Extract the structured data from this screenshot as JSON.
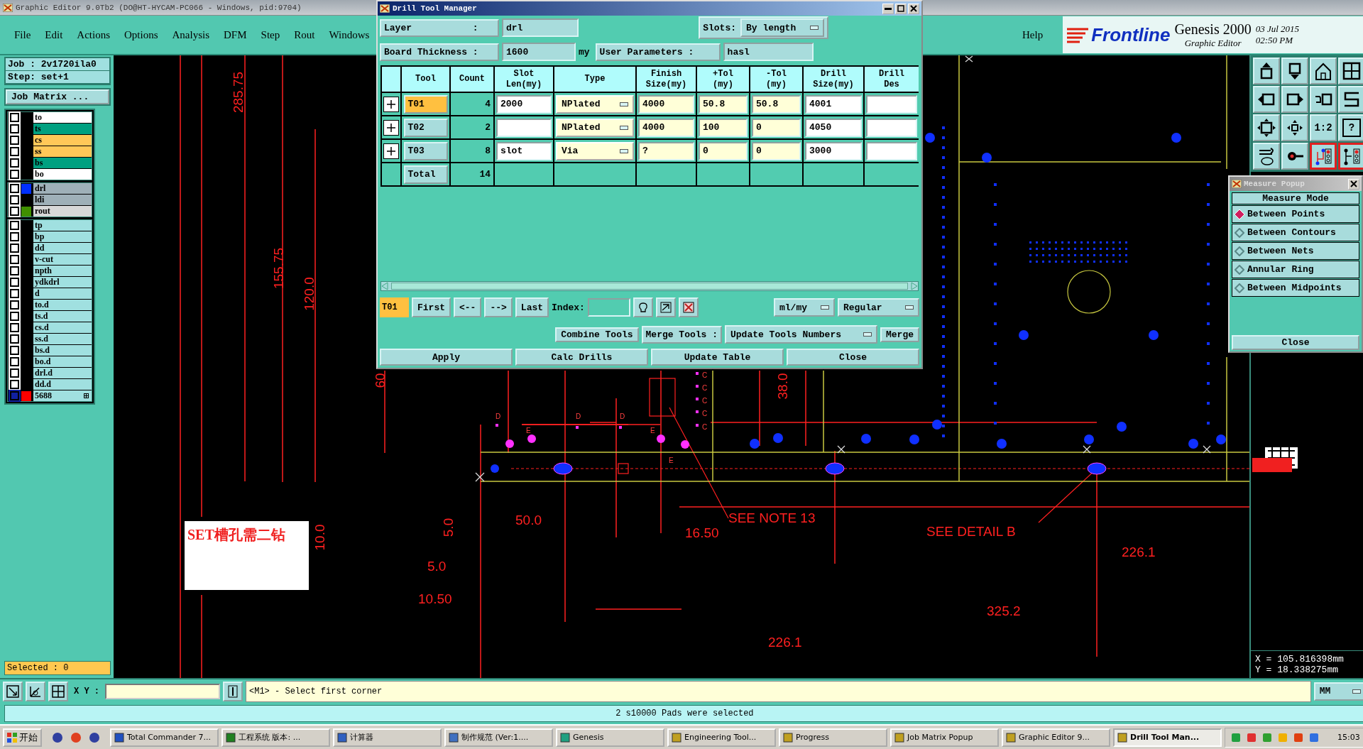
{
  "main_window": {
    "title": "Graphic Editor 9.0Tb2 (DO@HT-HYCAM-PC066 - Windows, pid:9704)"
  },
  "menu": [
    "File",
    "Edit",
    "Actions",
    "Options",
    "Analysis",
    "DFM",
    "Step",
    "Rout",
    "Windows"
  ],
  "help_menu": "Help",
  "brand": {
    "logo": "Frontline",
    "product": "Genesis 2000",
    "subtitle": "Graphic Editor",
    "date": "03 Jul 2015",
    "time": "02:50 PM"
  },
  "job_panel": {
    "job": "Job : 2v1720ila0",
    "step": "Step: set+1",
    "matrix_button": "Job Matrix ...",
    "selected": "Selected : 0"
  },
  "layer_groups": [
    {
      "layers": [
        {
          "name": "to",
          "color": "#ffffff",
          "affected": false
        },
        {
          "name": "ts",
          "color": "#00a080",
          "affected": false
        },
        {
          "name": "cs",
          "color": "#ffc858",
          "affected": false
        },
        {
          "name": "ss",
          "color": "#ffc858",
          "affected": false
        },
        {
          "name": "bs",
          "color": "#00a080",
          "affected": false
        },
        {
          "name": "bo",
          "color": "#ffffff",
          "affected": false
        }
      ]
    },
    {
      "layers": [
        {
          "name": "drl",
          "color": "#9fb0b8",
          "swatch": {
            "color": "#0030ff"
          },
          "affected": false
        },
        {
          "name": "ldi",
          "color": "#9fb0b8",
          "affected": false
        },
        {
          "name": "rout",
          "color": "#d8d8d8",
          "swatch": {
            "color": "#409000"
          },
          "affected": false
        }
      ]
    },
    {
      "layers": [
        {
          "name": "tp",
          "color": "#a0e0e0",
          "affected": false
        },
        {
          "name": "bp",
          "color": "#a0e0e0",
          "affected": false
        },
        {
          "name": "dd",
          "color": "#a0e0e0",
          "affected": false
        },
        {
          "name": "v-cut",
          "color": "#a0e0e0",
          "affected": false
        },
        {
          "name": "npth",
          "color": "#a0e0e0",
          "affected": false
        },
        {
          "name": "ydkdrl",
          "color": "#a0e0e0",
          "affected": false
        },
        {
          "name": "d",
          "color": "#a0e0e0",
          "affected": false
        },
        {
          "name": "to.d",
          "color": "#a0e0e0",
          "affected": false
        },
        {
          "name": "ts.d",
          "color": "#a0e0e0",
          "affected": false
        },
        {
          "name": "cs.d",
          "color": "#a0e0e0",
          "affected": false
        },
        {
          "name": "ss.d",
          "color": "#a0e0e0",
          "affected": false
        },
        {
          "name": "bs.d",
          "color": "#a0e0e0",
          "affected": false
        },
        {
          "name": "bo.d",
          "color": "#a0e0e0",
          "affected": false
        },
        {
          "name": "drl.d",
          "color": "#a0e0e0",
          "affected": false
        },
        {
          "name": "dd.d",
          "color": "#a0e0e0",
          "affected": false
        },
        {
          "name": "5688",
          "color": "#a0e0e0",
          "swatch": {
            "color": "#ff0000"
          },
          "affected": true
        }
      ]
    }
  ],
  "canvas": {
    "labels": [
      "285.75",
      "155.75",
      "120.0",
      "60",
      "38.0",
      "SEE NOTE 13",
      "16.50",
      "50.0",
      "5.0",
      "10.0",
      "5.0",
      "10.50",
      "SEE DETAIL B",
      "226.1",
      "325.2",
      "226.1"
    ],
    "markers": [
      "D",
      "E",
      "D",
      "D",
      "E",
      "E",
      "C",
      "C",
      "C",
      "C",
      "C"
    ],
    "note": "SET槽孔需二钻"
  },
  "toolbar": [
    {
      "on": false
    },
    {
      "on": false
    },
    {
      "on": false
    },
    {
      "on": false
    },
    {
      "on": false
    },
    {
      "on": false
    },
    {
      "on": false
    },
    {
      "on": false
    },
    {
      "on": false
    },
    {
      "on": false
    },
    {
      "label": "1:2",
      "on": false
    },
    {
      "label": "?",
      "on": false
    },
    {
      "on": false
    },
    {
      "on": false
    },
    {
      "on": true
    },
    {
      "on": true
    }
  ],
  "coordinates": {
    "x": "X = 105.816398mm",
    "y": "Y = 18.338275mm"
  },
  "measure_popup": {
    "title": "Measure Popup",
    "heading": "Measure Mode",
    "modes": [
      {
        "label": "Between Points",
        "selected": true
      },
      {
        "label": "Between Contours",
        "selected": false
      },
      {
        "label": "Between Nets",
        "selected": false
      },
      {
        "label": "Annular Ring",
        "selected": false
      },
      {
        "label": "Between Midpoints",
        "selected": false
      }
    ],
    "close": "Close"
  },
  "drill_tool_manager": {
    "title": "Drill Tool Manager",
    "layer_label": "Layer           :",
    "layer": "drl",
    "slots_label": "Slots:",
    "slots": "By length",
    "thickness_label": "Board Thickness :",
    "thickness": "1600",
    "thickness_unit": "my",
    "user_params_label": "User Parameters :",
    "user_params": "hasl",
    "columns": [
      "Tool",
      "Count",
      "Slot\nLen(my)",
      "Type",
      "Finish\nSize(my)",
      "+Tol\n(my)",
      "-Tol\n(my)",
      "Drill\nSize(my)",
      "Drill\nDes"
    ],
    "rows": [
      {
        "tool": "T01",
        "selected": true,
        "count": "4",
        "slot_len": "2000",
        "type": "NPlated",
        "finish_size": "4000",
        "plus_tol": "50.8",
        "minus_tol": "50.8",
        "drill_size": "4001"
      },
      {
        "tool": "T02",
        "selected": false,
        "count": "2",
        "type": "NPlated",
        "finish_size": "4000",
        "plus_tol": "100",
        "minus_tol": "0",
        "drill_size": "4050"
      },
      {
        "tool": "T03",
        "selected": false,
        "count": "8",
        "slot_len": "slot",
        "type": "Via",
        "finish_size": "?",
        "plus_tol": "0",
        "minus_tol": "0",
        "drill_size": "3000"
      }
    ],
    "total_label": "Total",
    "total": "14",
    "current_tool": "T01",
    "nav": [
      "First",
      "<--",
      "-->",
      "Last"
    ],
    "index_label": "Index:",
    "units": "ml/my",
    "mode": "Regular",
    "combine": "Combine Tools",
    "merge_label": "Merge Tools :",
    "merge_mode": "Update Tools Numbers",
    "merge": "Merge",
    "actions": [
      "Apply",
      "Calc Drills",
      "Update Table",
      "Close"
    ]
  },
  "command_bar": {
    "xy_label": "X Y :",
    "prompt": "<M1> - Select first corner",
    "units": "MM"
  },
  "status": "2 s10000 Pads were selected",
  "taskbar": {
    "start": "开始",
    "tasks": [
      {
        "label": "Total Commander 7...",
        "active": false
      },
      {
        "label": "工程系统   版本: ...",
        "active": false
      },
      {
        "label": "计算器",
        "active": false
      },
      {
        "label": "制作规范 (Ver:1....",
        "active": false
      },
      {
        "label": "Genesis",
        "active": false
      },
      {
        "label": "Engineering Tool...",
        "active": false
      },
      {
        "label": "Progress",
        "active": false
      },
      {
        "label": "Job Matrix Popup",
        "active": false
      },
      {
        "label": "Graphic Editor 9...",
        "active": false
      },
      {
        "label": "Drill Tool Man...",
        "active": true
      }
    ],
    "clock": "15:03"
  }
}
